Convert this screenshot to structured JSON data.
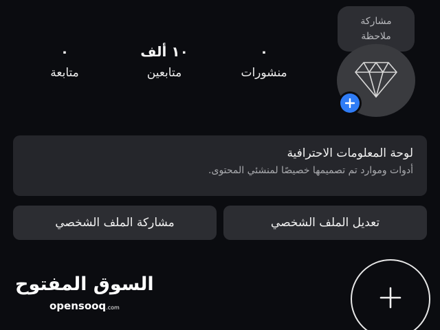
{
  "profile": {
    "note_bubble": {
      "line1": "مشاركة",
      "line2": "ملاحظة"
    },
    "avatar_icon": "diamond-icon",
    "add_story_icon": "plus-icon"
  },
  "stats": [
    {
      "value": "٠",
      "label": "منشورات"
    },
    {
      "value": "١٠ ألف",
      "label": "متابعين"
    },
    {
      "value": "٠",
      "label": "متابعة"
    }
  ],
  "dashboard": {
    "title": "لوحة المعلومات الاحترافية",
    "subtitle": "أدوات وموارد تم تصميمها خصيصًا لمنشئي المحتوى."
  },
  "buttons": {
    "edit_profile": "تعديل الملف الشخصي",
    "share_profile": "مشاركة الملف الشخصي"
  },
  "watermark": {
    "arabic": "السوق المفتوح",
    "latin": "opensooq",
    "suffix": ".com"
  },
  "fab": {
    "icon": "plus-icon"
  },
  "colors": {
    "background": "#0b0c10",
    "card": "#25262b",
    "accent": "#2f7cf6"
  }
}
